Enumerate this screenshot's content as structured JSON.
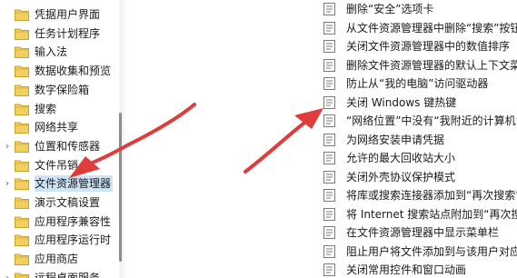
{
  "tree": {
    "items": [
      {
        "label": "凭据用户界面",
        "expandable": false,
        "selected": false
      },
      {
        "label": "任务计划程序",
        "expandable": false,
        "selected": false
      },
      {
        "label": "输入法",
        "expandable": false,
        "selected": false
      },
      {
        "label": "数据收集和预览",
        "expandable": false,
        "selected": false
      },
      {
        "label": "数字保险箱",
        "expandable": false,
        "selected": false
      },
      {
        "label": "搜索",
        "expandable": false,
        "selected": false
      },
      {
        "label": "网络共享",
        "expandable": false,
        "selected": false
      },
      {
        "label": "位置和传感器",
        "expandable": true,
        "selected": false
      },
      {
        "label": "文件吊销",
        "expandable": false,
        "selected": false
      },
      {
        "label": "文件资源管理器",
        "expandable": true,
        "selected": true
      },
      {
        "label": "演示文稿设置",
        "expandable": false,
        "selected": false
      },
      {
        "label": "应用程序兼容性",
        "expandable": false,
        "selected": false
      },
      {
        "label": "应用程序运行时",
        "expandable": false,
        "selected": false
      },
      {
        "label": "应用商店",
        "expandable": false,
        "selected": false
      },
      {
        "label": "远程桌面服务",
        "expandable": true,
        "selected": false
      }
    ]
  },
  "settings": {
    "items": [
      {
        "label": "删除“安全”选项卡"
      },
      {
        "label": "从文件资源管理器中删除“搜索”按钮"
      },
      {
        "label": "关闭文件资源管理器中的数值排序"
      },
      {
        "label": "删除文件资源管理器的默认上下文菜单"
      },
      {
        "label": "防止从“我的电脑”访问驱动器"
      },
      {
        "label": "关闭 Windows 键热键"
      },
      {
        "label": "“网络位置”中没有“我附近的计算机”"
      },
      {
        "label": "为网络安装申请凭据"
      },
      {
        "label": "允许的最大回收站大小"
      },
      {
        "label": "关闭外壳协议保护模式"
      },
      {
        "label": "将库或搜索连接器添加到“再次搜索”"
      },
      {
        "label": "将 Internet 搜索站点附加到“再次搜索”"
      },
      {
        "label": "在文件资源管理器中显示菜单栏"
      },
      {
        "label": "阻止用户将文件添加到与该用户对应的"
      },
      {
        "label": "关闭常用控件和窗口动画"
      }
    ]
  },
  "colors": {
    "folder": "#e8c04a",
    "selection": "#cce4f7",
    "arrow": "#e03c3c"
  }
}
